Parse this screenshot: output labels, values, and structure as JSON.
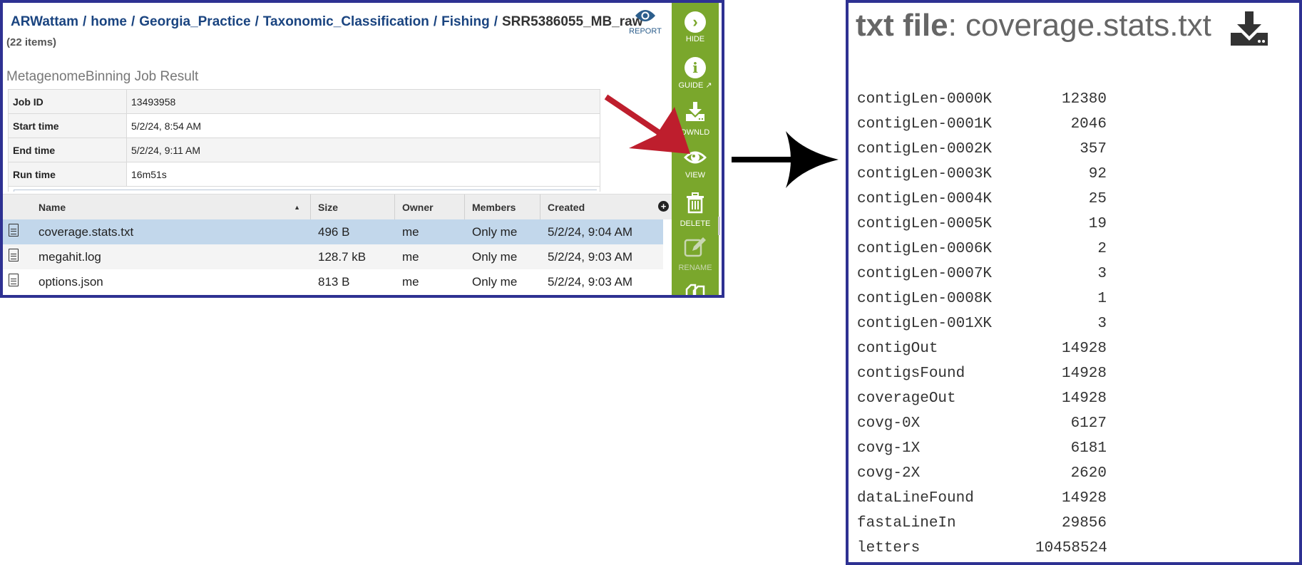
{
  "left_panel": {
    "breadcrumb": [
      "ARWattam",
      "home",
      "Georgia_Practice",
      "Taxonomic_Classification",
      "Fishing"
    ],
    "breadcrumb_current": "SRR5386055_MB_raw",
    "item_count": "(22 items)",
    "report_label": "REPORT",
    "job_title": "MetagenomeBinning Job Result",
    "job_info": [
      {
        "key": "Job ID",
        "value": "13493958"
      },
      {
        "key": "Start time",
        "value": "5/2/24, 8:54 AM"
      },
      {
        "key": "End time",
        "value": "5/2/24, 9:11 AM"
      },
      {
        "key": "Run time",
        "value": "16m51s"
      }
    ],
    "columns": [
      "Name",
      "Size",
      "Owner",
      "Members",
      "Created"
    ],
    "files": [
      {
        "name": "coverage.stats.txt",
        "size": "496 B",
        "owner": "me",
        "members": "Only me",
        "created": "5/2/24, 9:04 AM",
        "selected": true
      },
      {
        "name": "megahit.log",
        "size": "128.7 kB",
        "owner": "me",
        "members": "Only me",
        "created": "5/2/24, 9:03 AM",
        "selected": false
      },
      {
        "name": "options.json",
        "size": "813 B",
        "owner": "me",
        "members": "Only me",
        "created": "5/2/24, 9:03 AM",
        "selected": false
      }
    ],
    "sidebar": [
      {
        "label": "HIDE",
        "icon": "chevron-right-circle-icon"
      },
      {
        "label": "GUIDE",
        "icon": "info-circle-icon"
      },
      {
        "label": "DWNLD",
        "icon": "download-icon"
      },
      {
        "label": "VIEW",
        "icon": "eye-icon"
      },
      {
        "label": "DELETE",
        "icon": "trash-icon"
      },
      {
        "label": "RENAME",
        "icon": "edit-icon"
      }
    ],
    "colors": {
      "sidebar": "#7aa72c",
      "selected_row": "#c2d7eb",
      "frame": "#2e3192",
      "annotation_arrow": "#be1e2d"
    }
  },
  "right_panel": {
    "title_type": "txt file",
    "title_sep": ":",
    "title_name": "coverage.stats.txt",
    "stats": [
      {
        "key": "contigLen-0000K",
        "value": "12380"
      },
      {
        "key": "contigLen-0001K",
        "value": "2046"
      },
      {
        "key": "contigLen-0002K",
        "value": "357"
      },
      {
        "key": "contigLen-0003K",
        "value": "92"
      },
      {
        "key": "contigLen-0004K",
        "value": "25"
      },
      {
        "key": "contigLen-0005K",
        "value": "19"
      },
      {
        "key": "contigLen-0006K",
        "value": "2"
      },
      {
        "key": "contigLen-0007K",
        "value": "3"
      },
      {
        "key": "contigLen-0008K",
        "value": "1"
      },
      {
        "key": "contigLen-001XK",
        "value": "3"
      },
      {
        "key": "contigOut",
        "value": "14928"
      },
      {
        "key": "contigsFound",
        "value": "14928"
      },
      {
        "key": "coverageOut",
        "value": "14928"
      },
      {
        "key": "covg-0X",
        "value": "6127"
      },
      {
        "key": "covg-1X",
        "value": "6181"
      },
      {
        "key": "covg-2X",
        "value": "2620"
      },
      {
        "key": "dataLineFound",
        "value": "14928"
      },
      {
        "key": "fastaLineIn",
        "value": "29856"
      },
      {
        "key": "letters",
        "value": "10458524"
      }
    ]
  }
}
